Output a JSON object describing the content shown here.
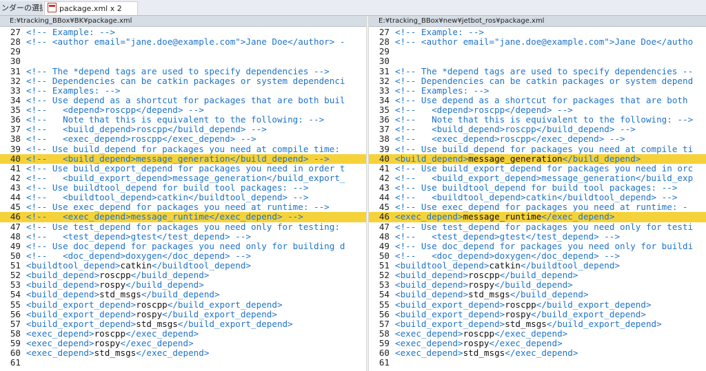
{
  "tabs": [
    {
      "label": "ンダーの選択..."
    },
    {
      "label": "package.xml x 2"
    }
  ],
  "panes": {
    "left": {
      "path": "E:¥tracking_BBox¥BK¥package.xml",
      "lines": [
        {
          "n": "27",
          "text": "<!-- Example: -->",
          "highlight": false
        },
        {
          "n": "28",
          "text": "<!-- <author email=\"jane.doe@example.com\">Jane Doe</author> -",
          "highlight": false
        },
        {
          "n": "29",
          "text": "",
          "highlight": false
        },
        {
          "n": "30",
          "text": "",
          "highlight": false
        },
        {
          "n": "31",
          "text": "<!-- The *depend tags are used to specify dependencies -->",
          "highlight": false
        },
        {
          "n": "32",
          "text": "<!-- Dependencies can be catkin packages or system dependenci",
          "highlight": false
        },
        {
          "n": "33",
          "text": "<!-- Examples: -->",
          "highlight": false
        },
        {
          "n": "34",
          "text": "<!-- Use depend as a shortcut for packages that are both buil",
          "highlight": false
        },
        {
          "n": "35",
          "text": "<!--   <depend>roscpp</depend> -->",
          "highlight": false
        },
        {
          "n": "36",
          "text": "<!--   Note that this is equivalent to the following: -->",
          "highlight": false
        },
        {
          "n": "37",
          "text": "<!--   <build_depend>roscpp</build_depend> -->",
          "highlight": false
        },
        {
          "n": "38",
          "text": "<!--   <exec_depend>roscpp</exec_depend> -->",
          "highlight": false
        },
        {
          "n": "39",
          "text": "<!-- Use build_depend for packages you need at compile time: ",
          "highlight": false
        },
        {
          "n": "40",
          "text": "<!--   <build_depend>message_generation</build_depend> -->",
          "highlight": true
        },
        {
          "n": "41",
          "text": "<!-- Use build_export_depend for packages you need in order t",
          "highlight": false
        },
        {
          "n": "42",
          "text": "<!--   <build_export_depend>message_generation</build_export_",
          "highlight": false
        },
        {
          "n": "43",
          "text": "<!-- Use buildtool_depend for build tool packages: -->",
          "highlight": false
        },
        {
          "n": "44",
          "text": "<!--   <buildtool_depend>catkin</buildtool_depend> -->",
          "highlight": false
        },
        {
          "n": "45",
          "text": "<!-- Use exec_depend for packages you need at runtime: -->",
          "highlight": false
        },
        {
          "n": "46",
          "text": "<!--   <exec_depend>message_runtime</exec_depend> -->",
          "highlight": true
        },
        {
          "n": "47",
          "text": "<!-- Use test_depend for packages you need only for testing: ",
          "highlight": false
        },
        {
          "n": "48",
          "text": "<!--   <test_depend>gtest</test_depend> -->",
          "highlight": false
        },
        {
          "n": "49",
          "text": "<!-- Use doc_depend for packages you need only for building d",
          "highlight": false
        },
        {
          "n": "50",
          "text": "<!--   <doc_depend>doxygen</doc_depend> -->",
          "highlight": false
        },
        {
          "n": "51",
          "text": "<buildtool_depend>catkin</buildtool_depend>",
          "highlight": false
        },
        {
          "n": "52",
          "text": "<build_depend>roscpp</build_depend>",
          "highlight": false
        },
        {
          "n": "53",
          "text": "<build_depend>rospy</build_depend>",
          "highlight": false
        },
        {
          "n": "54",
          "text": "<build_depend>std_msgs</build_depend>",
          "highlight": false
        },
        {
          "n": "55",
          "text": "<build_export_depend>roscpp</build_export_depend>",
          "highlight": false
        },
        {
          "n": "56",
          "text": "<build_export_depend>rospy</build_export_depend>",
          "highlight": false
        },
        {
          "n": "57",
          "text": "<build_export_depend>std_msgs</build_export_depend>",
          "highlight": false
        },
        {
          "n": "58",
          "text": "<exec_depend>roscpp</exec_depend>",
          "highlight": false
        },
        {
          "n": "59",
          "text": "<exec_depend>rospy</exec_depend>",
          "highlight": false
        },
        {
          "n": "60",
          "text": "<exec_depend>std_msgs</exec_depend>",
          "highlight": false
        },
        {
          "n": "61",
          "text": "",
          "highlight": false
        }
      ]
    },
    "right": {
      "path": "E:¥tracking_BBox¥new¥jetbot_ros¥package.xml",
      "lines": [
        {
          "n": "27",
          "text": "<!-- Example: -->",
          "highlight": false
        },
        {
          "n": "28",
          "text": "<!-- <author email=\"jane.doe@example.com\">Jane Doe</autho",
          "highlight": false
        },
        {
          "n": "29",
          "text": "",
          "highlight": false
        },
        {
          "n": "30",
          "text": "",
          "highlight": false
        },
        {
          "n": "31",
          "text": "<!-- The *depend tags are used to specify dependencies --",
          "highlight": false
        },
        {
          "n": "32",
          "text": "<!-- Dependencies can be catkin packages or system depend",
          "highlight": false
        },
        {
          "n": "33",
          "text": "<!-- Examples: -->",
          "highlight": false
        },
        {
          "n": "34",
          "text": "<!-- Use depend as a shortcut for packages that are both ",
          "highlight": false
        },
        {
          "n": "35",
          "text": "<!--   <depend>roscpp</depend> -->",
          "highlight": false
        },
        {
          "n": "36",
          "text": "<!--   Note that this is equivalent to the following: -->",
          "highlight": false
        },
        {
          "n": "37",
          "text": "<!--   <build_depend>roscpp</build_depend> -->",
          "highlight": false
        },
        {
          "n": "38",
          "text": "<!--   <exec_depend>roscpp</exec_depend> -->",
          "highlight": false
        },
        {
          "n": "39",
          "text": "<!-- Use build_depend for packages you need at compile ti",
          "highlight": false
        },
        {
          "n": "40",
          "text": "<build_depend>message_generation</build_depend>",
          "highlight": true
        },
        {
          "n": "41",
          "text": "<!-- Use build_export_depend for packages you need in orc",
          "highlight": false
        },
        {
          "n": "42",
          "text": "<!--   <build_export_depend>message_generation</build_exp",
          "highlight": false
        },
        {
          "n": "43",
          "text": "<!-- Use buildtool_depend for build tool packages: -->",
          "highlight": false
        },
        {
          "n": "44",
          "text": "<!--   <buildtool_depend>catkin</buildtool_depend> -->",
          "highlight": false
        },
        {
          "n": "45",
          "text": "<!-- Use exec_depend for packages you need at runtime: -",
          "highlight": false
        },
        {
          "n": "46",
          "text": "<exec_depend>message_runtime</exec_depend>",
          "highlight": true
        },
        {
          "n": "47",
          "text": "<!-- Use test_depend for packages you need only for testi",
          "highlight": false
        },
        {
          "n": "48",
          "text": "<!--   <test_depend>gtest</test_depend> -->",
          "highlight": false
        },
        {
          "n": "49",
          "text": "<!-- Use doc_depend for packages you need only for buildi",
          "highlight": false
        },
        {
          "n": "50",
          "text": "<!--   <doc_depend>doxygen</doc_depend> -->",
          "highlight": false
        },
        {
          "n": "51",
          "text": "<buildtool_depend>catkin</buildtool_depend>",
          "highlight": false
        },
        {
          "n": "52",
          "text": "<build_depend>roscpp</build_depend>",
          "highlight": false
        },
        {
          "n": "53",
          "text": "<build_depend>rospy</build_depend>",
          "highlight": false
        },
        {
          "n": "54",
          "text": "<build_depend>std_msgs</build_depend>",
          "highlight": false
        },
        {
          "n": "55",
          "text": "<build_export_depend>roscpp</build_export_depend>",
          "highlight": false
        },
        {
          "n": "56",
          "text": "<build_export_depend>rospy</build_export_depend>",
          "highlight": false
        },
        {
          "n": "57",
          "text": "<build_export_depend>std_msgs</build_export_depend>",
          "highlight": false
        },
        {
          "n": "58",
          "text": "<exec_depend>roscpp</exec_depend>",
          "highlight": false
        },
        {
          "n": "59",
          "text": "<exec_depend>rospy</exec_depend>",
          "highlight": false
        },
        {
          "n": "60",
          "text": "<exec_depend>std_msgs</exec_depend>",
          "highlight": false
        },
        {
          "n": "61",
          "text": "",
          "highlight": false
        }
      ]
    }
  },
  "colors": {
    "markup": "#1e73c8",
    "element_text": "#111111",
    "diff_highlight": "#f5d23a"
  }
}
